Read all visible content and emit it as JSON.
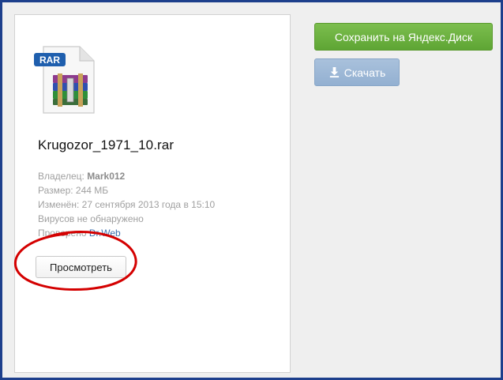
{
  "file": {
    "icon_badge": "RAR",
    "name": "Krugozor_1971_10.rar"
  },
  "meta": {
    "owner_label": "Владелец: ",
    "owner_value": "Mark012",
    "size_label": "Размер: ",
    "size_value": "244 МБ",
    "modified_label": "Изменён: ",
    "modified_value": "27 сентября 2013 года в 15:10",
    "virus_status": "Вирусов не обнаружено",
    "checked_label": "Проверено ",
    "checked_link": "Dr.Web"
  },
  "actions": {
    "view_label": "Просмотреть",
    "save_label": "Сохранить на Яндекс.Диск",
    "download_label": "Скачать"
  },
  "colors": {
    "save_green": "#6cb33f",
    "download_blue": "#9ab6d6",
    "annotation_red": "#d40000",
    "frame_blue": "#1d3f8c"
  }
}
